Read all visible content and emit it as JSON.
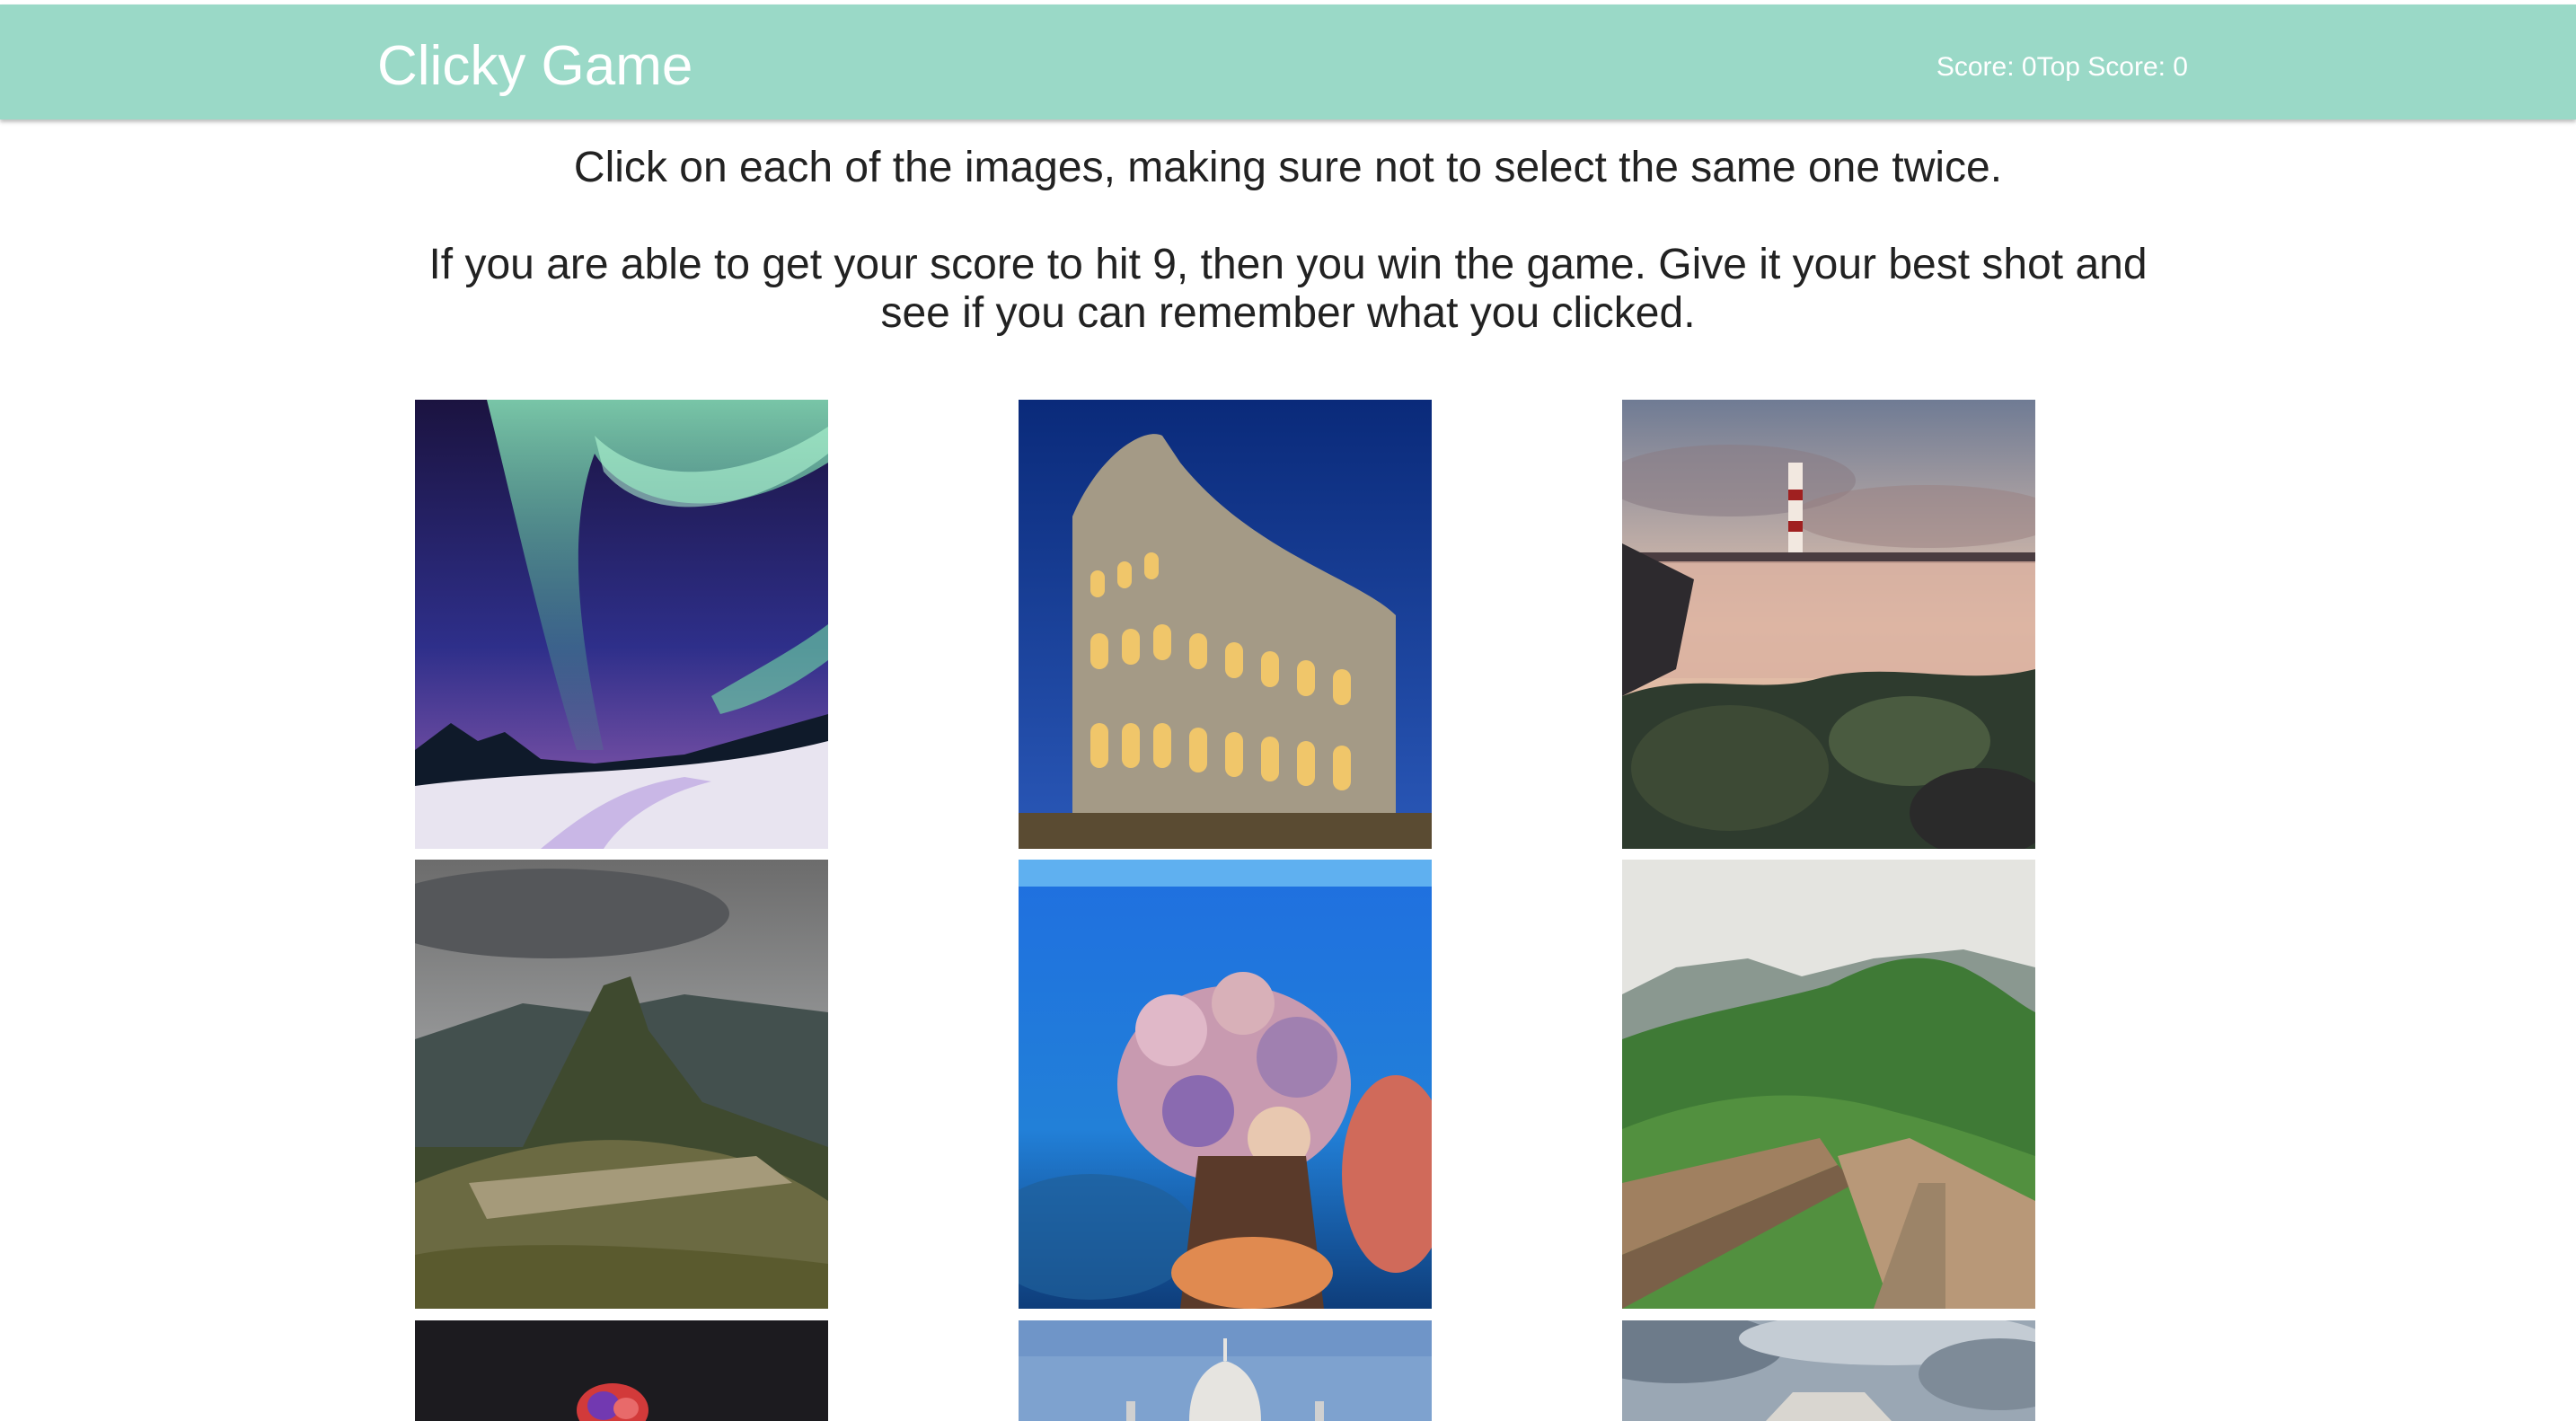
{
  "navbar": {
    "brand": "Clicky Game",
    "score_text": "Score: 0",
    "top_score_text": "Top Score: 0"
  },
  "instructions": {
    "line1": "Click on each of the images, making sure not to select the same one twice.",
    "line2": "If you are able to get your score to hit 9, then you win the game. Give it your best shot and see if you can remember what you clicked."
  },
  "images": [
    {
      "name": "aurora-borealis-image"
    },
    {
      "name": "colosseum-image"
    },
    {
      "name": "lighthouse-image"
    },
    {
      "name": "machu-picchu-image"
    },
    {
      "name": "coral-reef-image"
    },
    {
      "name": "great-wall-image"
    },
    {
      "name": "dark-volcano-image"
    },
    {
      "name": "taj-mahal-image"
    },
    {
      "name": "cloudy-landmark-image"
    }
  ],
  "colors": {
    "navbar_bg": "#9ad9c7",
    "navbar_text": "#ffffff",
    "body_text": "#222222"
  }
}
